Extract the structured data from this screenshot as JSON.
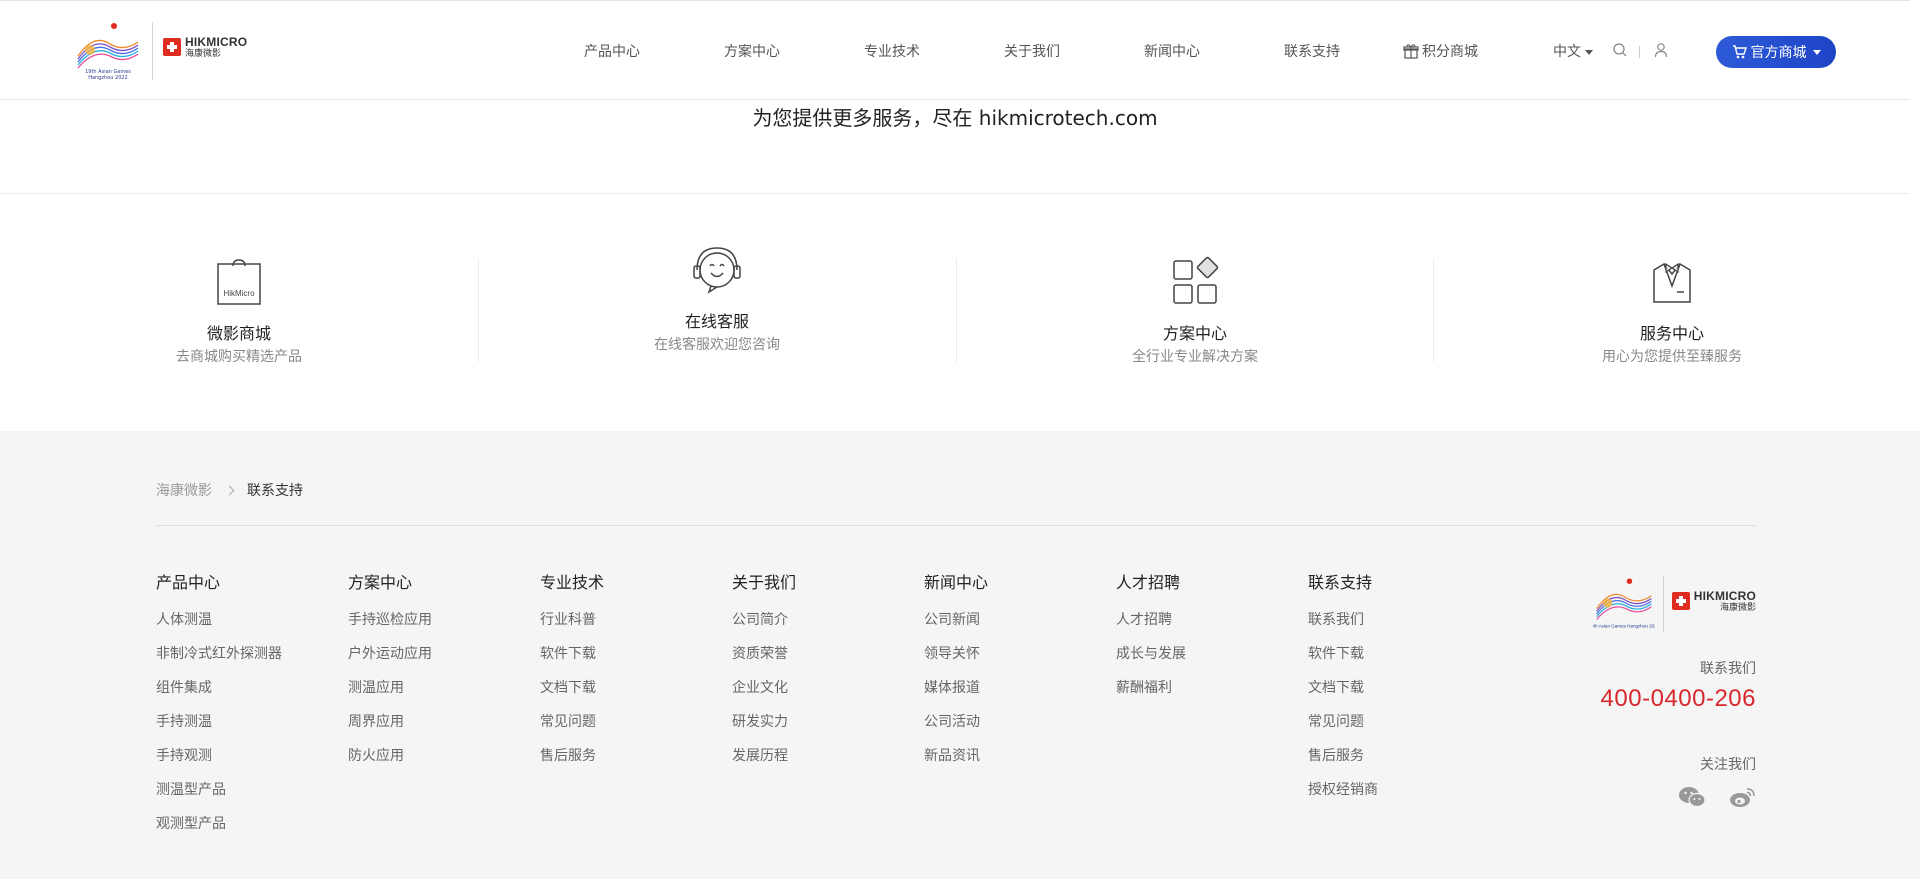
{
  "header": {
    "brand_en": "HIKMICRO",
    "brand_cn": "海康微影",
    "games_logo_text": "19th Asian Games Hangzhou 2022",
    "nav": [
      {
        "label": "产品中心"
      },
      {
        "label": "方案中心"
      },
      {
        "label": "专业技术"
      },
      {
        "label": "关于我们"
      },
      {
        "label": "新闻中心"
      },
      {
        "label": "联系支持"
      },
      {
        "label": "积分商城"
      }
    ],
    "language": "中文",
    "shop_button": "官方商城"
  },
  "promo_text": "为您提供更多服务，尽在 hikmicrotech.com",
  "services": [
    {
      "title": "微影商城",
      "subtitle": "去商城购买精选产品",
      "icon": "shopping-bag-icon",
      "icon_text": "HikMicro"
    },
    {
      "title": "在线客服",
      "subtitle": "在线客服欢迎您咨询",
      "icon": "headset-smiley-icon"
    },
    {
      "title": "方案中心",
      "subtitle": "全行业专业解决方案",
      "icon": "grid-squares-icon"
    },
    {
      "title": "服务中心",
      "subtitle": "用心为您提供至臻服务",
      "icon": "suit-bowtie-icon"
    }
  ],
  "footer": {
    "breadcrumb": [
      "海康微影",
      "联系支持"
    ],
    "columns": [
      {
        "title": "产品中心",
        "links": [
          "人体测温",
          "非制冷式红外探测器",
          "组件集成",
          "手持测温",
          "手持观测",
          "测温型产品",
          "观测型产品"
        ]
      },
      {
        "title": "方案中心",
        "links": [
          "手持巡检应用",
          "户外运动应用",
          "测温应用",
          "周界应用",
          "防火应用"
        ]
      },
      {
        "title": "专业技术",
        "links": [
          "行业科普",
          "软件下载",
          "文档下载",
          "常见问题",
          "售后服务"
        ]
      },
      {
        "title": "关于我们",
        "links": [
          "公司简介",
          "资质荣誉",
          "企业文化",
          "研发实力",
          "发展历程"
        ]
      },
      {
        "title": "新闻中心",
        "links": [
          "公司新闻",
          "领导关怀",
          "媒体报道",
          "公司活动",
          "新品资讯"
        ]
      },
      {
        "title": "人才招聘",
        "links": [
          "人才招聘",
          "成长与发展",
          "薪酬福利"
        ]
      },
      {
        "title": "联系支持",
        "links": [
          "联系我们",
          "软件下载",
          "文档下载",
          "常见问题",
          "售后服务",
          "授权经销商"
        ]
      }
    ],
    "contact_label": "联系我们",
    "phone": "400-0400-206",
    "follow_label": "关注我们",
    "social": [
      "wechat-icon",
      "weibo-icon"
    ]
  },
  "colors": {
    "accent_blue": "#2d5bd8",
    "phone_red": "#d8272d",
    "footer_bg": "#f5f5f5",
    "brand_red": "#e02b20"
  }
}
